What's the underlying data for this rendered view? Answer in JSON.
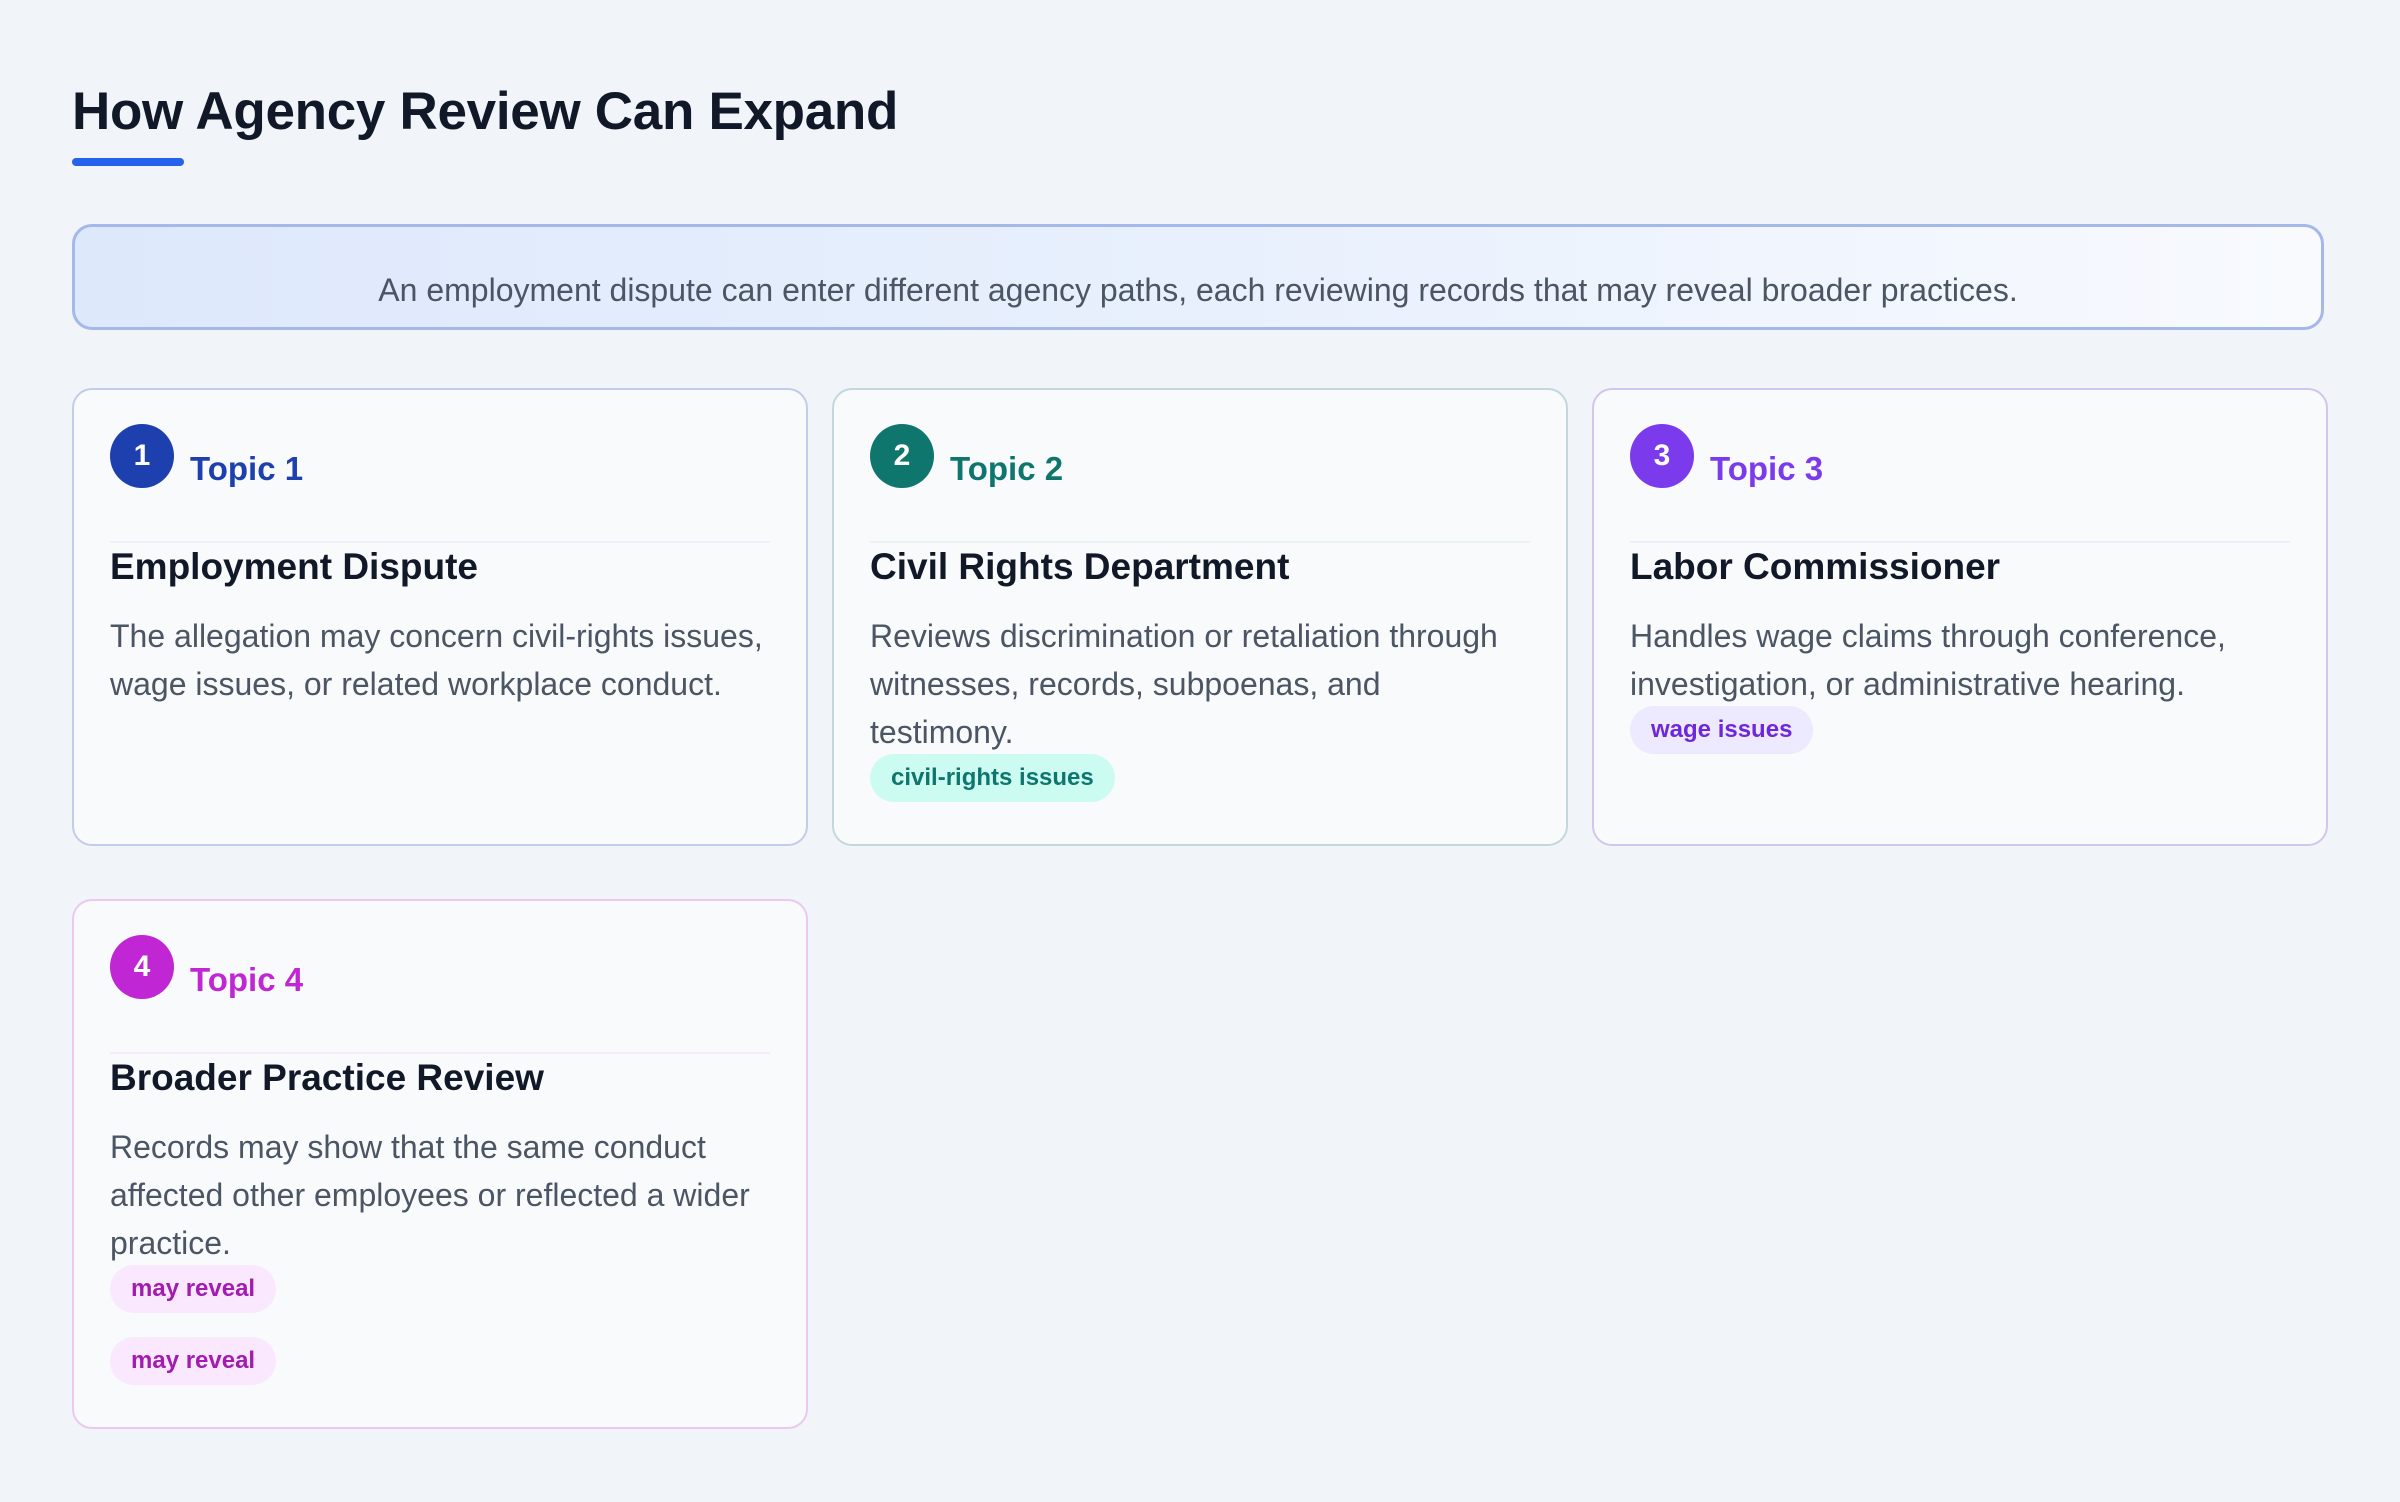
{
  "header": {
    "title": "How Agency Review Can Expand",
    "intro": "An employment dispute can enter different agency paths, each reviewing records that may reveal broader practices."
  },
  "colors": {
    "accent": "#2563eb",
    "topic1": "#1e40af",
    "topic2": "#0f766e",
    "topic3": "#7c3aed",
    "topic4": "#c026d3"
  },
  "cards": [
    {
      "number": "1",
      "topic": "Topic 1",
      "title": "Employment Dispute",
      "description": "The allegation may concern civil-rights issues, wage issues, or related workplace conduct.",
      "tags": []
    },
    {
      "number": "2",
      "topic": "Topic 2",
      "title": "Civil Rights Department",
      "description": "Reviews discrimination or retaliation through witnesses, records, subpoenas, and testimony.",
      "tags": [
        "civil-rights issues"
      ]
    },
    {
      "number": "3",
      "topic": "Topic 3",
      "title": "Labor Commissioner",
      "description": "Handles wage claims through conference, investigation, or administrative hearing.",
      "tags": [
        "wage issues"
      ]
    },
    {
      "number": "4",
      "topic": "Topic 4",
      "title": "Broader Practice Review",
      "description": "Records may show that the same conduct affected other employees or reflected a wider practice.",
      "tags": [
        "may reveal",
        "may reveal"
      ]
    }
  ]
}
